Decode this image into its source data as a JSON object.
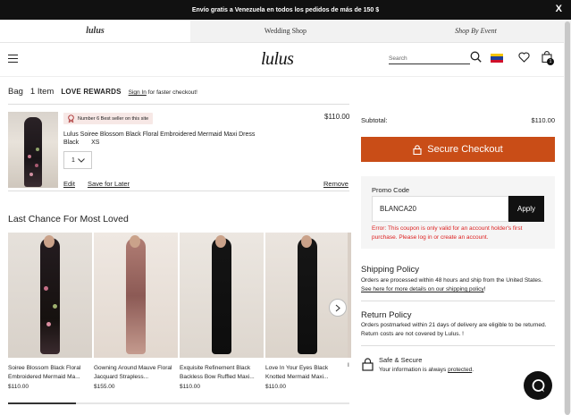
{
  "banner": {
    "text": "Envío gratis a Venezuela en todos los pedidos de más de 150 $",
    "close": "X"
  },
  "brand_tabs": [
    {
      "label": "lulus"
    },
    {
      "label": "Wedding Shop"
    },
    {
      "label": "Shop By Event"
    }
  ],
  "header": {
    "logo": "lulus",
    "search_placeholder": "Search",
    "bag_count": "1",
    "flag_colors": [
      "#f5c400",
      "#1d3f9a",
      "#d0102b"
    ]
  },
  "bag": {
    "title": "Bag",
    "count": "1 Item",
    "rewards": "LOVE REWARDS",
    "signin_link": "Sign In",
    "signin_suffix": "for faster checkout!"
  },
  "item": {
    "badge": "Number 6 Best seller on this site",
    "name": "Lulus Soiree Blossom Black Floral Embroidered Mermaid Maxi Dress",
    "color": "Black",
    "size": "XS",
    "quantity": "1",
    "price": "$110.00",
    "edit": "Edit",
    "save_later": "Save for Later",
    "remove": "Remove"
  },
  "carousel": {
    "title": "Last Chance For Most Loved",
    "products": [
      {
        "name": "Soiree Blossom Black Floral Embroidered Mermaid Ma...",
        "price": "$110.00"
      },
      {
        "name": "Gowning Around Mauve Floral Jacquard Strapless...",
        "price": "$155.00"
      },
      {
        "name": "Exquisite Refinement Black Backless Bow Ruffled Maxi...",
        "price": "$110.00"
      },
      {
        "name": "Love In Your Eyes Black Knotted Mermaid Maxi...",
        "price": "$110.00"
      }
    ],
    "partial_prefix": "I"
  },
  "summary": {
    "subtotal_label": "Subtotal:",
    "subtotal_value": "$110.00",
    "checkout": "Secure Checkout",
    "promo_label": "Promo Code",
    "promo_value": "BLANCA20",
    "apply": "Apply",
    "promo_error": "Error: This coupon is only valid for an account holder's first purchase. Please log in or create an account."
  },
  "shipping": {
    "title": "Shipping Policy",
    "text": "Orders are processed within 48 hours and ship from the United States.",
    "link": "See here for more details on our shipping policy",
    "link_suffix": "!"
  },
  "returns": {
    "title": "Return Policy",
    "text": "Orders postmarked within 21 days of delivery are eligible to be returned. Return costs are not covered by Lulus. !"
  },
  "secure": {
    "title": "Safe & Secure",
    "text": "Your information is always",
    "link": "protected",
    "suffix": "."
  }
}
